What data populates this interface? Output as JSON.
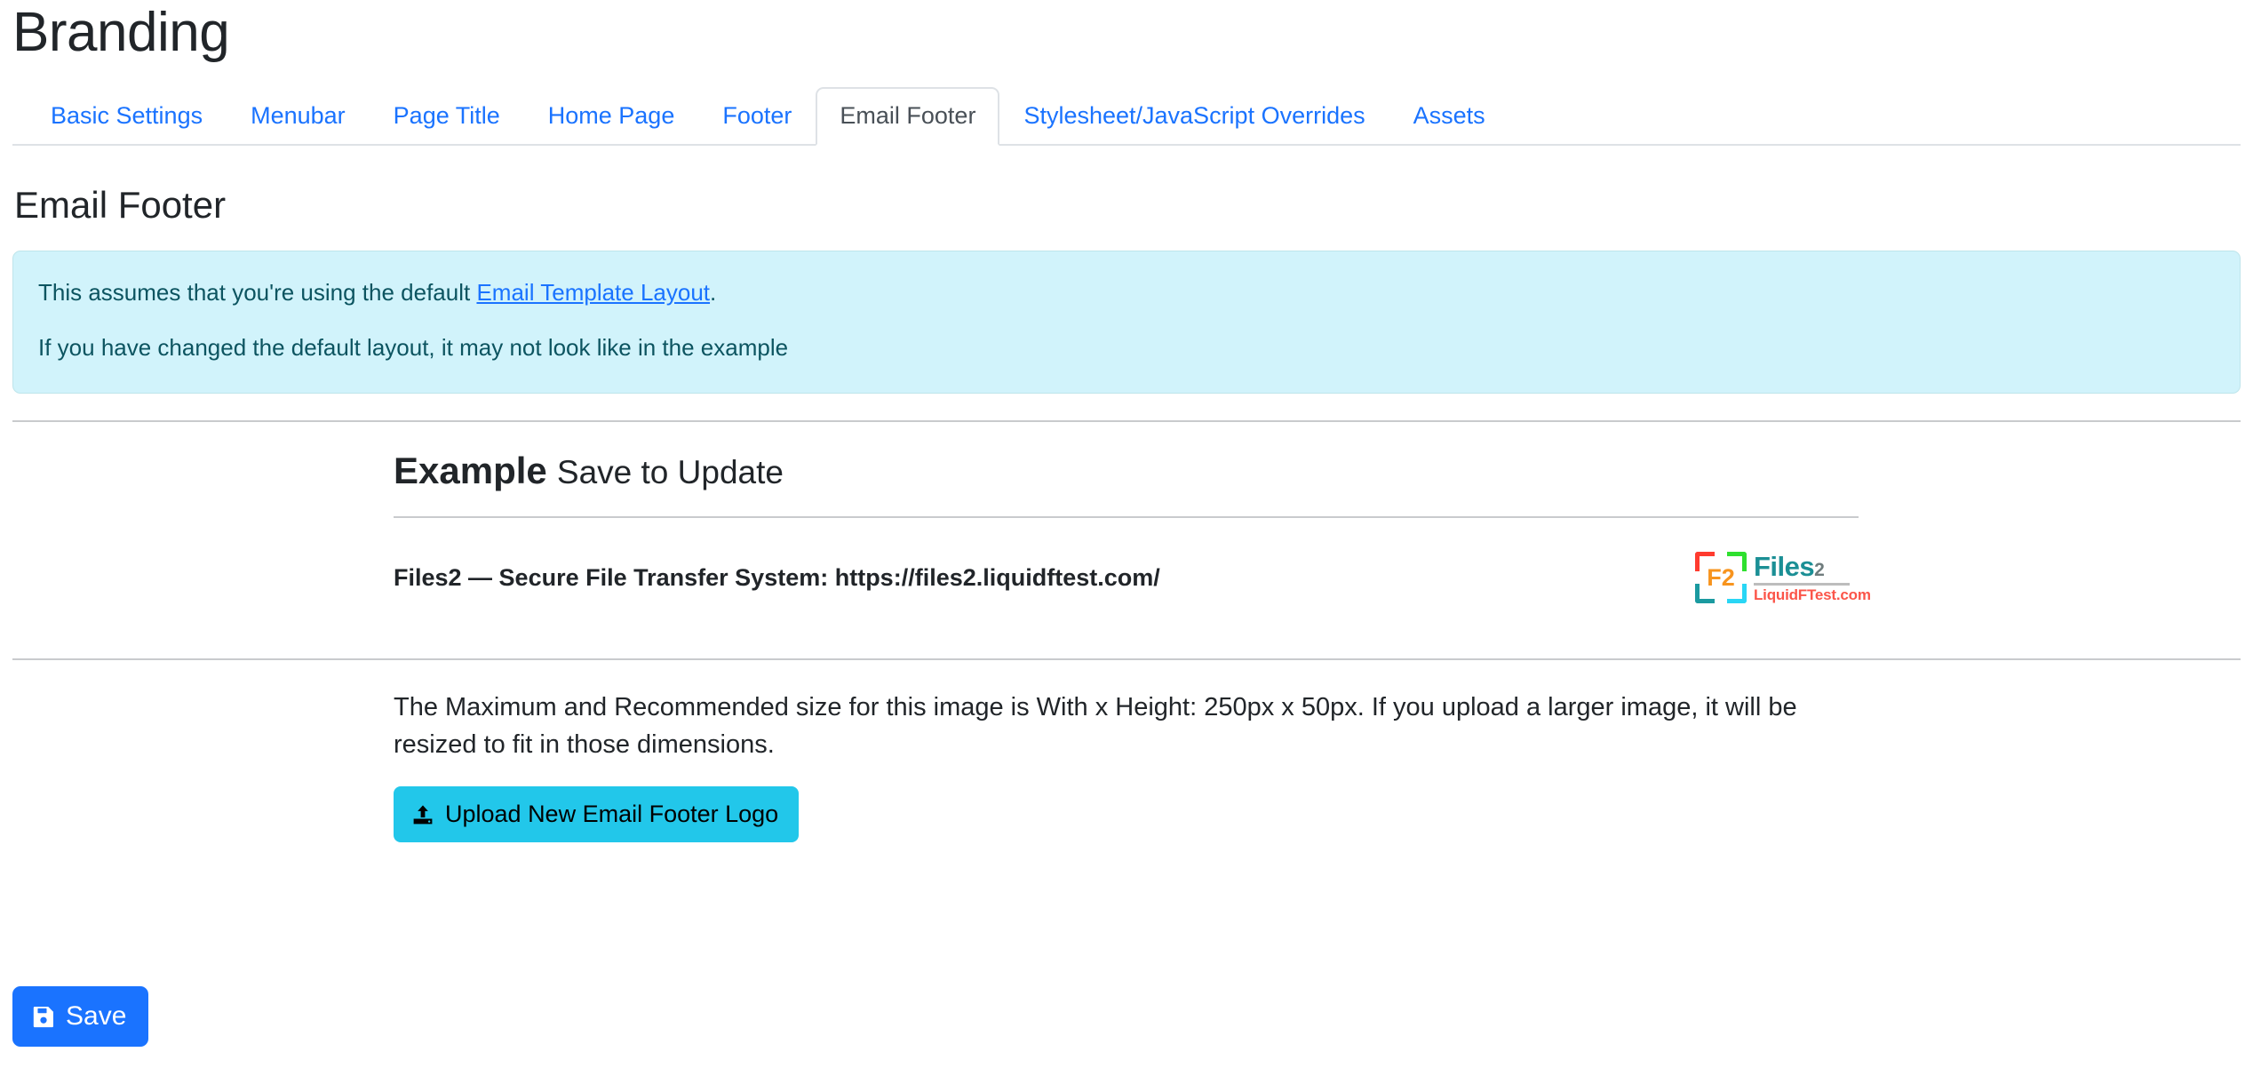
{
  "page": {
    "title": "Branding"
  },
  "tabs": [
    {
      "label": "Basic Settings",
      "active": false
    },
    {
      "label": "Menubar",
      "active": false
    },
    {
      "label": "Page Title",
      "active": false
    },
    {
      "label": "Home Page",
      "active": false
    },
    {
      "label": "Footer",
      "active": false
    },
    {
      "label": "Email Footer",
      "active": true
    },
    {
      "label": "Stylesheet/JavaScript Overrides",
      "active": false
    },
    {
      "label": "Assets",
      "active": false
    }
  ],
  "section": {
    "heading": "Email Footer"
  },
  "alert": {
    "line1_prefix": "This assumes that you're using the default ",
    "line1_link": "Email Template Layout",
    "line1_suffix": ".",
    "line2": "If you have changed the default layout, it may not look like in the example",
    "background_color": "#d1f3fb",
    "text_color": "#0c5460",
    "link_color": "#1a73ff"
  },
  "example": {
    "heading_strong": "Example",
    "heading_light": "Save to Update",
    "footer_line": "Files2 — Secure File Transfer System: https://files2.liquidftest.com/",
    "logo": {
      "mark_text": "F2",
      "brand_name": "Files",
      "brand_number": "2",
      "domain": "LiquidFTest.com",
      "corner_top_left_color": "#ff3b2f",
      "corner_top_right_color": "#2fe02f",
      "corner_bottom_left_color": "#1b9aa0",
      "corner_bottom_right_color": "#29d6f5",
      "mark_text_color": "#f7941e",
      "brand_color": "#1b8f95",
      "domain_color": "#fb5549"
    }
  },
  "help": {
    "text": "The Maximum and Recommended size for this image is With x Height: 250px x 50px. If you upload a larger image, it will be resized to fit in those dimensions.",
    "upload_button_label": "Upload New Email Footer Logo",
    "upload_button_color": "#22c7ea"
  },
  "footer_actions": {
    "save_label": "Save",
    "save_button_color": "#1a73ff"
  }
}
